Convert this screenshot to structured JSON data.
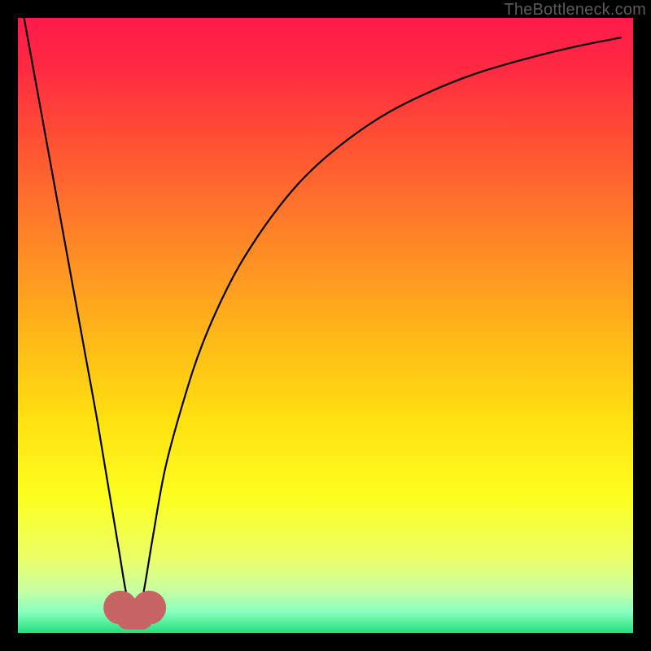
{
  "watermark": "TheBottleneck.com",
  "chart_data": {
    "type": "line",
    "title": "",
    "xlabel": "",
    "ylabel": "",
    "xlim": [
      0,
      100
    ],
    "ylim": [
      0,
      100
    ],
    "grid": false,
    "background": {
      "type": "vertical-gradient",
      "stops": [
        {
          "offset": 0.0,
          "color": "#ff1a4b"
        },
        {
          "offset": 0.08,
          "color": "#ff2a42"
        },
        {
          "offset": 0.2,
          "color": "#ff5034"
        },
        {
          "offset": 0.35,
          "color": "#ff8228"
        },
        {
          "offset": 0.5,
          "color": "#ffb21a"
        },
        {
          "offset": 0.65,
          "color": "#ffe010"
        },
        {
          "offset": 0.78,
          "color": "#fdff20"
        },
        {
          "offset": 0.88,
          "color": "#eaff6a"
        },
        {
          "offset": 0.93,
          "color": "#c8ffa2"
        },
        {
          "offset": 0.965,
          "color": "#8affc0"
        },
        {
          "offset": 1.0,
          "color": "#22e07a"
        }
      ]
    },
    "series": [
      {
        "name": "bottleneck-curve",
        "stroke": "#000000",
        "stroke_width": 2.2,
        "x": [
          1,
          3,
          5,
          7,
          9,
          11,
          13,
          15,
          16.5,
          17.5,
          18.5,
          19.5,
          20.5,
          22,
          24,
          27,
          30,
          34,
          38,
          43,
          48,
          54,
          60,
          67,
          74,
          82,
          90,
          98
        ],
        "y": [
          100,
          89,
          78,
          67,
          56,
          45,
          34,
          22,
          13,
          7,
          2.5,
          2.5,
          7,
          16,
          27,
          38,
          47,
          56,
          63,
          70,
          75.5,
          80.5,
          84.5,
          88,
          90.8,
          93.2,
          95.2,
          96.8
        ]
      }
    ],
    "marker": {
      "name": "optimal-dip",
      "shape": "double-blob",
      "color": "#c86464",
      "x": 19,
      "y": 2.5,
      "size": 5
    }
  }
}
